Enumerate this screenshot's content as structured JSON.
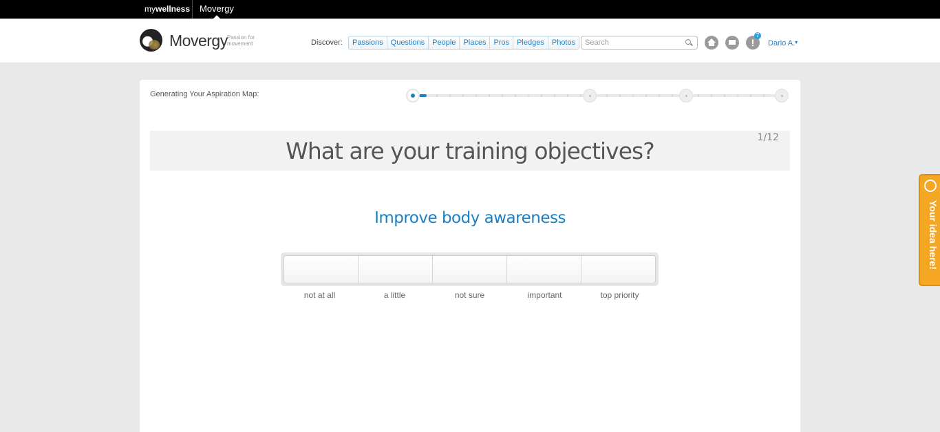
{
  "topbar": {
    "brand_my": "my",
    "brand_wellness": "wellness",
    "active_tab": "Movergy"
  },
  "header": {
    "logo_text": "Movergy",
    "logo_tagline": "Passion for movement",
    "discover_label": "Discover:",
    "nav": [
      "Passions",
      "Questions",
      "People",
      "Places",
      "Pros",
      "Pledges",
      "Photos"
    ],
    "search_placeholder": "Search",
    "notifications_count": "7",
    "user_name": "Dario A.",
    "user_caret": "▾",
    "alert_glyph": "!"
  },
  "wizard": {
    "title": "Generating Your Aspiration Map:",
    "step_progress": 0.04,
    "question": "What are your training objectives?",
    "counter": "1/12",
    "objective": "Improve body awareness",
    "ratings": [
      "not at all",
      "a little",
      "not sure",
      "important",
      "top priority"
    ]
  },
  "feedback_tab": {
    "label": "Your idea here!"
  },
  "colors": {
    "accent": "#1a7fc3",
    "feedback": "#f5a623"
  },
  "icons": [
    "search-icon",
    "home-icon",
    "mail-icon",
    "alert-icon",
    "lightbulb-icon"
  ]
}
